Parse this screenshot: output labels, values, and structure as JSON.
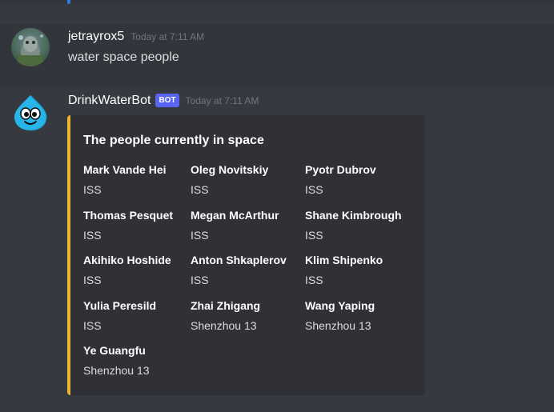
{
  "messages": {
    "user": {
      "username": "jetrayrox5",
      "timestamp": "Today at 7:11 AM",
      "content": "water space people"
    },
    "bot": {
      "username": "DrinkWaterBot",
      "tag": "BOT",
      "timestamp": "Today at 7:11 AM",
      "embed": {
        "accent_color": "#f0b232",
        "title": "The people currently in space",
        "fields": [
          {
            "name": "Mark Vande Hei",
            "value": "ISS"
          },
          {
            "name": "Oleg Novitskiy",
            "value": "ISS"
          },
          {
            "name": "Pyotr Dubrov",
            "value": "ISS"
          },
          {
            "name": "Thomas Pesquet",
            "value": "ISS"
          },
          {
            "name": "Megan McArthur",
            "value": "ISS"
          },
          {
            "name": "Shane Kimbrough",
            "value": "ISS"
          },
          {
            "name": "Akihiko Hoshide",
            "value": "ISS"
          },
          {
            "name": "Anton Shkaplerov",
            "value": "ISS"
          },
          {
            "name": "Klim Shipenko",
            "value": "ISS"
          },
          {
            "name": "Yulia Peresild",
            "value": "ISS"
          },
          {
            "name": "Zhai Zhigang",
            "value": "Shenzhou 13"
          },
          {
            "name": "Wang Yaping",
            "value": "Shenzhou 13"
          },
          {
            "name": "Ye Guangfu",
            "value": "Shenzhou 13"
          }
        ]
      }
    }
  },
  "colors": {
    "background": "#36393f",
    "embed_background": "#2f3136",
    "bot_tag": "#5865f2",
    "timestamp": "#72767d"
  }
}
